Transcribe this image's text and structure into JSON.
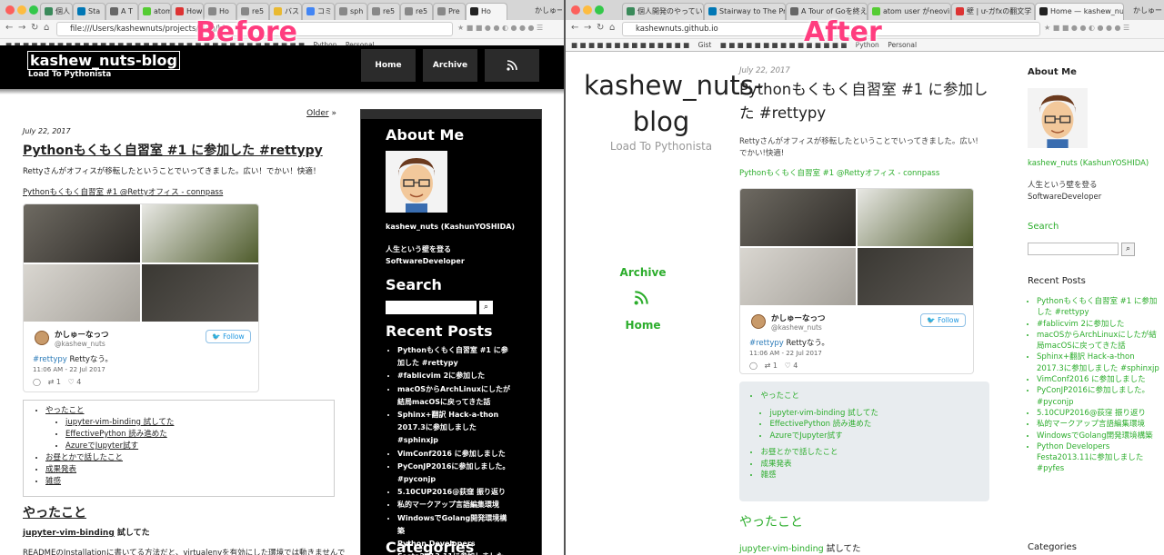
{
  "before_label": "Before",
  "after_label": "After",
  "left_browser": {
    "tabs": [
      "個人",
      "Sta",
      "A T",
      "atom",
      "How",
      "Ho",
      "re5",
      "バス",
      "コミ",
      "sph",
      "re5",
      "re5",
      "Pre",
      "Ho",
      "かしゅー"
    ],
    "url": "file:///Users/kashewnuts/projects/blog/bl",
    "bookmarks": [
      "Python",
      "Personal"
    ]
  },
  "right_browser": {
    "tabs": [
      "個人開発のやっていき",
      "Stairway to The Prag",
      "A Tour of Goを終えた",
      "atom user がneovim",
      "壁 | ư-ガfxの翻文学",
      "Home — kashew_nuts",
      "かしゅー"
    ],
    "url": "kashewnuts.github.io",
    "bookmarks": [
      "Gist",
      "Python",
      "Personal"
    ]
  },
  "before": {
    "header": {
      "title": "kashew_nuts-blog",
      "subtitle": "Load To Pythonista",
      "nav": [
        "Home",
        "Archive",
        "rss"
      ]
    },
    "older": "Older",
    "older_arrow": "»",
    "post": {
      "date": "July 22, 2017",
      "title": "Pythonもくもく自習室 #1 に参加した #rettypy",
      "text": "Rettyさんがオフィスが移転したということでいってきました。広い！でかい！快適！",
      "link": "Pythonもくもく自習室 #1 @Rettyオフィス - connpass"
    },
    "tweet": {
      "name": "かしゅーなっつ",
      "handle": "@kashew_nuts",
      "follow": "Follow",
      "hashtag": "#rettypy",
      "text": " Rettyなう。",
      "time": "11:06 AM - 22 Jul 2017",
      "retweets": "1",
      "likes": "4"
    },
    "toc": {
      "item1": "やったこと",
      "sub": [
        "jupyter-vim-binding 試してた",
        "EffectivePython 読み進めた",
        "AzureでJupyter試す"
      ],
      "item2": "お昼とかで話したこと",
      "item3": "成果発表",
      "item4": "雑感"
    },
    "h2": "やったこと",
    "h3_link": "jupyter-vim-binding",
    "h3_rest": " 試してた",
    "para": "READMEのInstallationに書いてる方法だと、virtualenvを有効にした環境では動きませんで",
    "sidebar": {
      "about": "About Me",
      "name": "kashew_nuts (KashunYOSHIDA)",
      "bio1": "人生という壁を登る",
      "bio2": "SoftwareDeveloper",
      "search": "Search",
      "recent": "Recent Posts",
      "categories": "Categories",
      "posts": [
        "Pythonもくもく自習室 #1 に参加した #rettypy",
        "#fablicvim 2に参加した",
        "macOSからArchLinuxにしたが結局macOSに戻ってきた話",
        "Sphinx+翻訳 Hack-a-thon 2017.3に参加しました #sphinxjp",
        "VimConf2016 に参加しました",
        "PyConJP2016に参加しました。 #pyconjp",
        "5.10CUP2016@荻窪 振り返り",
        "私的マークアップ言語編集環境",
        "WindowsでGolang開発環境構築",
        "Python Developers Festa2013.11に参加しました #pyfes"
      ]
    }
  },
  "after": {
    "blog_title": "kashew_nuts-blog",
    "subtitle": "Load To Pythonista",
    "nav_archive": "Archive",
    "nav_home": "Home",
    "post": {
      "date": "July 22, 2017",
      "title": "Pythonもくもく自習室 #1 に参加した #rettypy",
      "text": "Rettyさんがオフィスが移転したということでいってきました。広い!でかい!快適!",
      "link": "Pythonもくもく自習室 #1 @Rettyオフィス - connpass"
    },
    "tweet": {
      "name": "かしゅーなっつ",
      "handle": "@kashew_nuts",
      "follow": "Follow",
      "hashtag": "#rettypy",
      "text": " Rettyなう。",
      "time": "11:06 AM - 22 Jul 2017",
      "retweets": "1",
      "likes": "4"
    },
    "toc": {
      "item1": "やったこと",
      "sub": [
        "jupyter-vim-binding 試してた",
        "EffectivePython 読み進めた",
        "AzureでJupyter試す"
      ],
      "item2": "お昼とかで話したこと",
      "item3": "成果発表",
      "item4": "雑感"
    },
    "h2": "やったこと",
    "h3_link": "jupyter-vim-binding",
    "h3_rest": " 試してた",
    "sidebar": {
      "about": "About Me",
      "name": "kashew_nuts (KashunYOSHIDA)",
      "bio1": "人生という壁を登る",
      "bio2": "SoftwareDeveloper",
      "search": "Search",
      "recent": "Recent Posts",
      "categories": "Categories",
      "posts": [
        "Pythonもくもく自習室 #1 に参加した #rettypy",
        "#fablicvim 2に参加した",
        "macOSからArchLinuxにしたが結局macOSに戻ってきた話",
        "Sphinx+翻訳 Hack-a-thon 2017.3に参加しました #sphinxjp",
        "VimConf2016 に参加しました",
        "PyConJP2016に参加しました。 #pyconjp",
        "5.10CUP2016@荻窪 振り返り",
        "私的マークアップ言語編集環境",
        "WindowsでGolang開発環境構築",
        "Python Developers Festa2013.11に参加しました #pyfes"
      ]
    }
  },
  "colors": {
    "accent_green": "#2cad2c",
    "label_pink": "#ff3d7f",
    "twitter_blue": "#1b95e0"
  }
}
